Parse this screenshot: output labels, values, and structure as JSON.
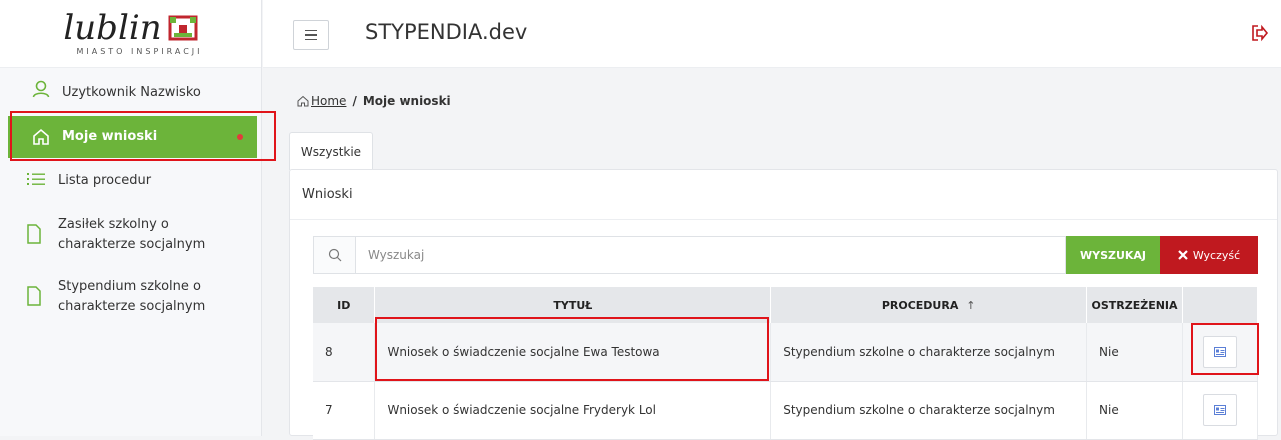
{
  "logo": {
    "word": "lublin",
    "subtitle": "MIASTO INSPIRACJI"
  },
  "sidebar": {
    "user": "Uzytkownik Nazwisko",
    "items": [
      {
        "label": "Moje wnioski"
      },
      {
        "label": "Lista procedur"
      },
      {
        "label": "Zasiłek szkolny o charakterze socjalnym"
      },
      {
        "label": "Stypendium szkolne o charakterze socjalnym"
      }
    ]
  },
  "header": {
    "title": "STYPENDIA.dev"
  },
  "breadcrumb": {
    "home": "Home",
    "separator": "/",
    "current": "Moje wnioski"
  },
  "tabs": [
    {
      "label": "Wszystkie"
    }
  ],
  "card": {
    "title": "Wnioski"
  },
  "search": {
    "placeholder": "Wyszukaj",
    "search_label": "WYSZUKAJ",
    "clear_label": "Wyczyść"
  },
  "table": {
    "headers": {
      "id": "ID",
      "title": "TYTUŁ",
      "procedure": "PROCEDURA",
      "warnings": "OSTRZEŻENIA",
      "sort_indicator": "↑"
    },
    "rows": [
      {
        "id": "8",
        "title": "Wniosek o świadczenie socjalne Ewa Testowa",
        "procedure": "Stypendium szkolne o charakterze socjalnym",
        "warnings": "Nie"
      },
      {
        "id": "7",
        "title": "Wniosek o świadczenie socjalne Fryderyk Lol",
        "procedure": "Stypendium szkolne o charakterze socjalnym",
        "warnings": "Nie"
      }
    ]
  },
  "colors": {
    "accent_green": "#6cb43a",
    "danger_red": "#c0191f",
    "highlight_red": "#e0141a"
  }
}
